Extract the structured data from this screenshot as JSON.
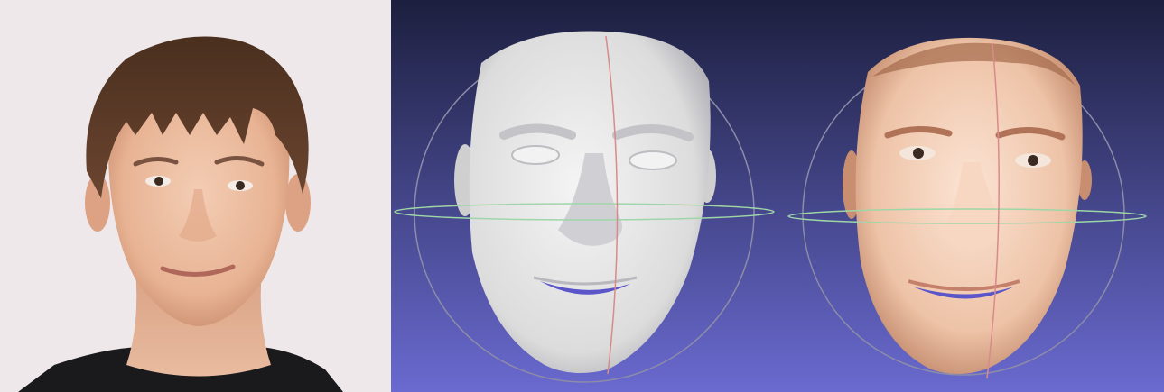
{
  "figure": {
    "panels": [
      {
        "id": "photo",
        "kind": "photograph"
      },
      {
        "id": "render-shaded",
        "kind": "3d-mesh-viewer",
        "background": [
          "#1c1f3e",
          "#6a6ad0"
        ]
      },
      {
        "id": "render-textured",
        "kind": "3d-mesh-viewer",
        "background": [
          "#1c1f3e",
          "#6a6ad0"
        ]
      }
    ],
    "colors": {
      "photo_background": "#efe8ea",
      "skin": "#efc2a6",
      "hair": "#5a3a25",
      "shirt": "#1a1a1d",
      "mesh_gray": "#e8e8e8",
      "trackball_vertical": "#d98a8a",
      "trackball_horizontal": "#9fd6a8",
      "trackball_ring": "#8c8ca8"
    }
  }
}
